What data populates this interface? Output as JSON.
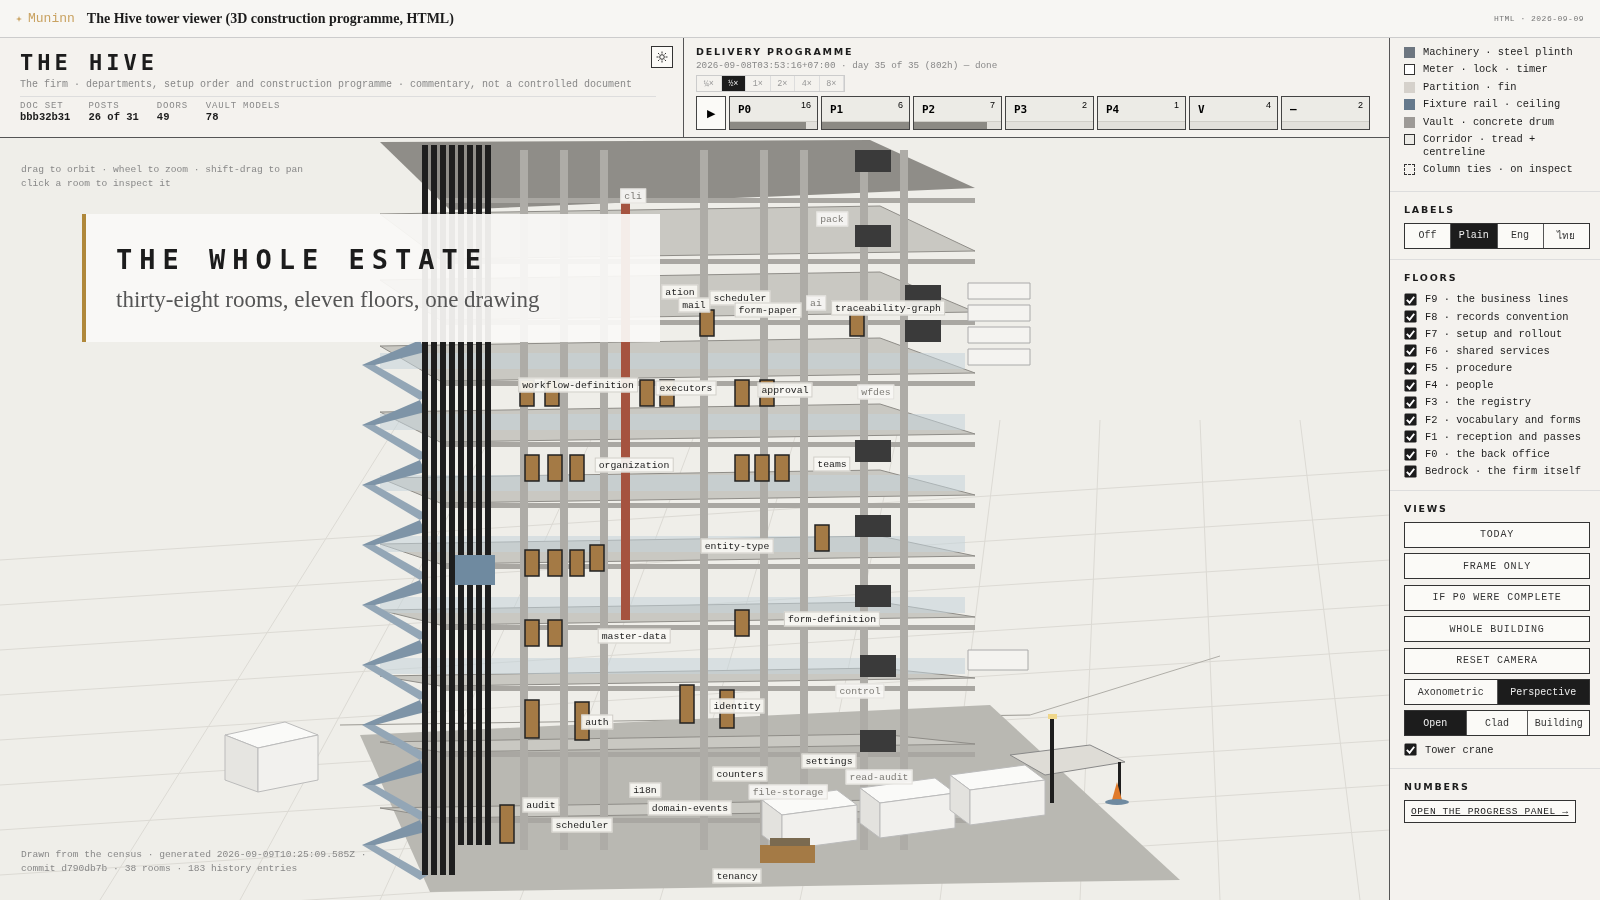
{
  "window": {
    "app": "Muninn",
    "title": "The Hive tower viewer (3D construction programme, HTML)",
    "meta": "HTML · 2026-09-09"
  },
  "header": {
    "title": "THE HIVE",
    "subtitle": "The firm · departments, setup order and construction programme · commentary, not a controlled document",
    "stats": [
      {
        "label": "DOC SET",
        "value": "bbb32b31"
      },
      {
        "label": "POSTS",
        "value": "26 of 31"
      },
      {
        "label": "DOORS",
        "value": "49"
      },
      {
        "label": "VAULT MODELS",
        "value": "78"
      }
    ]
  },
  "delivery": {
    "title": "DELIVERY PROGRAMME",
    "status": "2026-09-08T03:53:16+07:00 · day 35 of 35 (802h) — done",
    "speeds": [
      {
        "label": "¼×",
        "selected": false
      },
      {
        "label": "½×",
        "selected": true
      },
      {
        "label": "1×",
        "selected": false
      },
      {
        "label": "2×",
        "selected": false
      },
      {
        "label": "4×",
        "selected": false
      },
      {
        "label": "8×",
        "selected": false
      }
    ],
    "play": "▶",
    "phases": [
      {
        "label": "P0",
        "count": "16",
        "level": 0.87
      },
      {
        "label": "P1",
        "count": "6",
        "level": 1
      },
      {
        "label": "P2",
        "count": "7",
        "level": 0.84
      },
      {
        "label": "P3",
        "count": "2",
        "level": 0
      },
      {
        "label": "P4",
        "count": "1",
        "level": 0
      },
      {
        "label": "V",
        "count": "4",
        "level": 0
      },
      {
        "label": "—",
        "count": "2",
        "level": 0
      }
    ]
  },
  "scene": {
    "hints": [
      "drag to orbit · wheel to zoom · shift-drag to pan",
      "click a room to inspect it"
    ],
    "card": {
      "title": "THE WHOLE ESTATE",
      "subtitle": "thirty-eight rooms, eleven floors, one drawing"
    },
    "rooms": [
      {
        "label": "cli",
        "faded": true
      },
      {
        "label": "pack",
        "faded": true
      },
      {
        "label": "ation",
        "faded": false
      },
      {
        "label": "mail",
        "faded": false
      },
      {
        "label": "scheduler",
        "faded": false
      },
      {
        "label": "form-paper",
        "faded": false
      },
      {
        "label": "ai",
        "faded": true
      },
      {
        "label": "traceability-graph",
        "faded": false
      },
      {
        "label": "workflow-definition",
        "faded": false
      },
      {
        "label": "executors",
        "faded": false
      },
      {
        "label": "approval",
        "faded": false
      },
      {
        "label": "wfdes",
        "faded": true
      },
      {
        "label": "organization",
        "faded": false
      },
      {
        "label": "teams",
        "faded": false
      },
      {
        "label": "entity-type",
        "faded": false
      },
      {
        "label": "form-definition",
        "faded": false
      },
      {
        "label": "master-data",
        "faded": false
      },
      {
        "label": "control",
        "faded": true
      },
      {
        "label": "identity",
        "faded": false
      },
      {
        "label": "auth",
        "faded": false
      },
      {
        "label": "settings",
        "faded": false
      },
      {
        "label": "counters",
        "faded": false
      },
      {
        "label": "i18n",
        "faded": false
      },
      {
        "label": "file-storage",
        "faded": true
      },
      {
        "label": "read-audit",
        "faded": true
      },
      {
        "label": "audit",
        "faded": false
      },
      {
        "label": "domain-events",
        "faded": false
      },
      {
        "label": "scheduler",
        "faded": false
      },
      {
        "label": "tenancy",
        "faded": false
      }
    ],
    "footer": "Drawn from the census · generated 2026-09-09T10:25:09.585Z · commit d790db7b · 38 rooms · 183 history entries"
  },
  "sidebar": {
    "legend": [
      {
        "label": "Machinery · steel plinth",
        "kind": "fill",
        "color": "#6d7680"
      },
      {
        "label": "Meter · lock · timer",
        "kind": "outline",
        "color": "#ffffff"
      },
      {
        "label": "Partition · fin",
        "kind": "fill",
        "color": "#d5d1cb"
      },
      {
        "label": "Fixture rail · ceiling",
        "kind": "fill",
        "color": "#65798c"
      },
      {
        "label": "Vault · concrete drum",
        "kind": "fill",
        "color": "#9d9a96"
      },
      {
        "label": "Corridor · tread + centreline",
        "kind": "outline",
        "color": "#ecebe6"
      },
      {
        "label": "Column ties · on inspect",
        "kind": "dashed"
      }
    ],
    "labels": {
      "title": "LABELS",
      "options": [
        {
          "label": "Off",
          "selected": false
        },
        {
          "label": "Plain",
          "selected": true
        },
        {
          "label": "Eng",
          "selected": false
        },
        {
          "label": "ไทย",
          "selected": false
        }
      ]
    },
    "floors": {
      "title": "FLOORS",
      "items": [
        {
          "label": "F9 · the business lines",
          "checked": true
        },
        {
          "label": "F8 · records convention",
          "checked": true
        },
        {
          "label": "F7 · setup and rollout",
          "checked": true
        },
        {
          "label": "F6 · shared services",
          "checked": true
        },
        {
          "label": "F5 · procedure",
          "checked": true
        },
        {
          "label": "F4 · people",
          "checked": true
        },
        {
          "label": "F3 · the registry",
          "checked": true
        },
        {
          "label": "F2 · vocabulary and forms",
          "checked": true
        },
        {
          "label": "F1 · reception and passes",
          "checked": true
        },
        {
          "label": "F0 · the back office",
          "checked": true
        },
        {
          "label": "Bedrock · the firm itself",
          "checked": true
        }
      ]
    },
    "views": {
      "title": "VIEWS",
      "buttons": [
        "TODAY",
        "FRAME ONLY",
        "IF P0 WERE COMPLETE",
        "WHOLE BUILDING",
        "RESET CAMERA"
      ],
      "projection": [
        {
          "label": "Axonometric",
          "selected": false
        },
        {
          "label": "Perspective",
          "selected": true
        }
      ],
      "mode": [
        {
          "label": "Open",
          "selected": true
        },
        {
          "label": "Clad",
          "selected": false
        },
        {
          "label": "Building",
          "selected": false
        }
      ],
      "crane": {
        "label": "Tower crane",
        "checked": true
      }
    },
    "numbers": {
      "title": "NUMBERS",
      "link": "OPEN THE PROGRESS PANEL →"
    }
  }
}
